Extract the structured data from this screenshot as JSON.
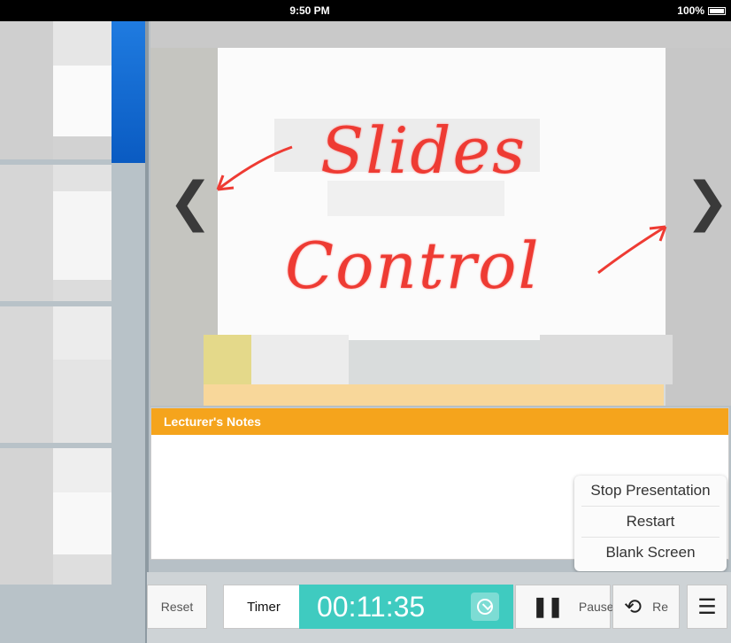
{
  "status_bar": {
    "time": "9:50 PM",
    "battery": "100%"
  },
  "slide": {
    "prev_icon": "chevron-left-icon",
    "next_icon": "chevron-right-icon",
    "annotation_line1": "Slides",
    "annotation_line2": "Control"
  },
  "notes": {
    "title": "Lecturer's Notes"
  },
  "menu": {
    "items": [
      "Stop Presentation",
      "Restart",
      "Blank Screen"
    ]
  },
  "toolbar": {
    "reset_label": "Reset",
    "timer_label": "Timer",
    "timer_value": "00:11:35",
    "pause_label": "Pause",
    "restart_label": "Re",
    "menu_icon": "list-icon"
  },
  "colors": {
    "accent": "#f5a41c",
    "timer": "#3fcbc0",
    "annotation": "#ee3b33",
    "active_thumb": "#1f7be0"
  }
}
